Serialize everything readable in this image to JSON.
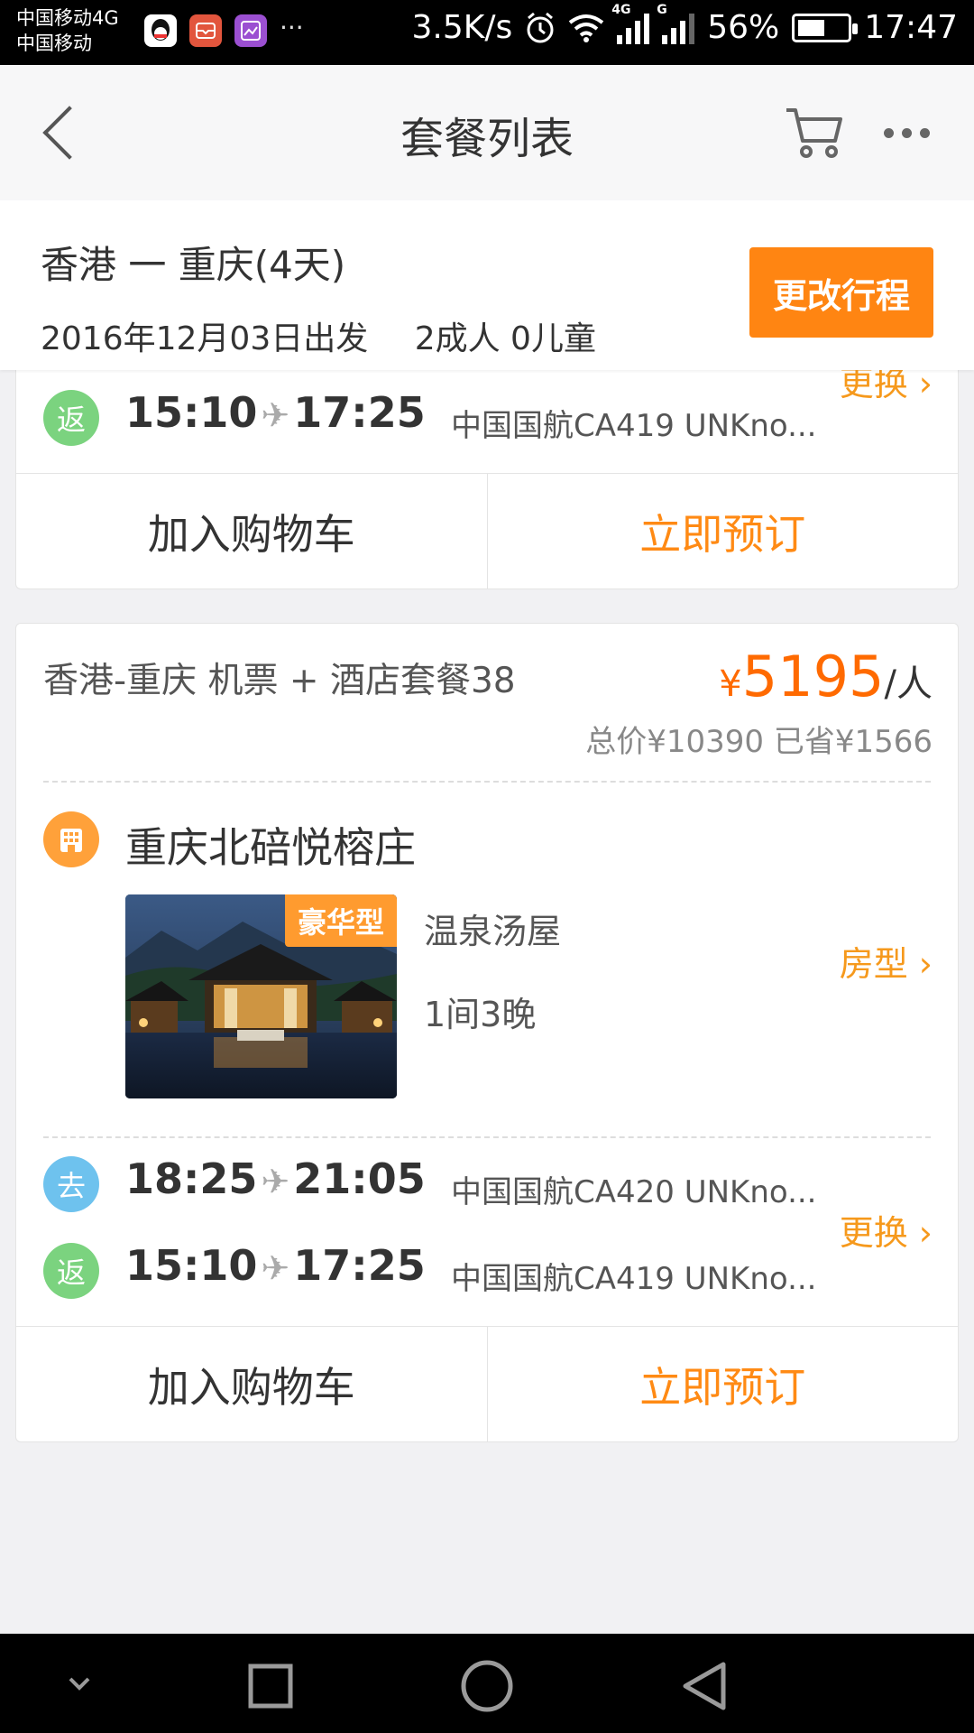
{
  "status_bar": {
    "carrier_top": "中国移动4G",
    "carrier_bottom": "中国移动",
    "more": "···",
    "speed": "3.5K/s",
    "net1": "4G",
    "net2": "G",
    "battery": "56%",
    "battery_level": 0.56,
    "time": "17:47"
  },
  "header": {
    "title": "套餐列表",
    "back_icon": "back-chevron-icon",
    "cart_icon": "cart-icon",
    "more_icon": "more-dots-icon"
  },
  "summary": {
    "route": "香港 一 重庆(4天)",
    "depart_date": "2016年12月03日出发",
    "travelers": "2成人  0儿童",
    "change_button": "更改行程"
  },
  "card1": {
    "return_badge": "返",
    "return_depart": "15:10",
    "return_arrive": "17:25",
    "return_flight": "中国国航CA419  UNKno...",
    "swap_label": "更换",
    "add_cart": "加入购物车",
    "book_now": "立即预订"
  },
  "card2": {
    "package_name": "香港-重庆 机票 + 酒店套餐38",
    "price_currency": "¥",
    "price_value": "5195",
    "price_unit": "/人",
    "price_total": "总价¥10390  已省¥1566",
    "hotel_name": "重庆北碚悦榕庄",
    "hotel_tag": "豪华型",
    "room_type": "温泉汤屋",
    "room_count": "1间3晚",
    "room_link": "房型",
    "go_badge": "去",
    "go_depart": "18:25",
    "go_arrive": "21:05",
    "go_flight": "中国国航CA420  UNKno...",
    "return_badge": "返",
    "return_depart": "15:10",
    "return_arrive": "17:25",
    "return_flight": "中国国航CA419  UNKno...",
    "swap_label": "更换",
    "add_cart": "加入购物车",
    "book_now": "立即预订"
  },
  "colors": {
    "accent_orange": "#ff8512",
    "price_orange": "#ff6a00",
    "return_green": "#7bd37f",
    "go_blue": "#6ec2ee",
    "hotel_orange": "#ffa13a"
  }
}
